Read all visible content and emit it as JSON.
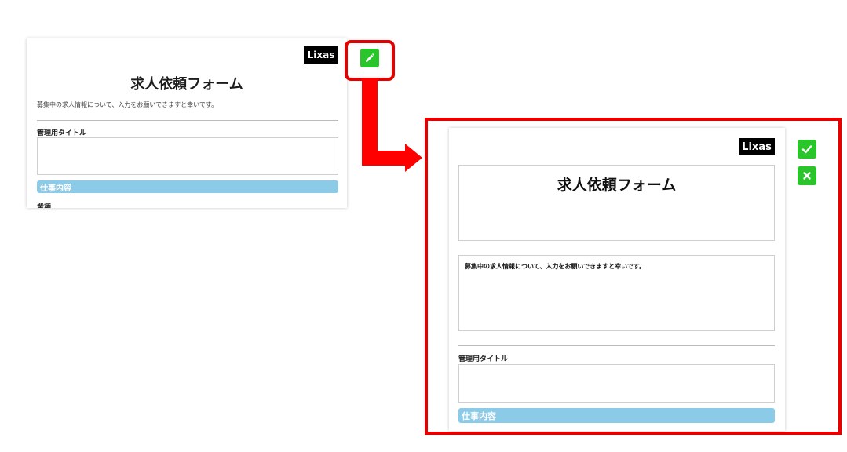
{
  "before": {
    "logo": "Lixas",
    "title": "求人依頼フォーム",
    "description": "募集中の求人情報について、入力をお願いできますと幸いです。",
    "field_label": "管理用タイトル",
    "section_label": "仕事内容",
    "cut_label": "業種"
  },
  "edit_icon": "pencil-icon",
  "after": {
    "logo": "Lixas",
    "title": "求人依頼フォーム",
    "description": "募集中の求人情報について、入力をお願いできますと幸いです。",
    "field_label": "管理用タイトル",
    "section_label": "仕事内容",
    "confirm_icon": "check-icon",
    "cancel_icon": "close-icon"
  },
  "colors": {
    "highlight": "#e60000",
    "arrow": "#ff0000",
    "button_green": "#2ac52a",
    "section_blue": "#8ccbe8",
    "logo_bg": "#000000"
  }
}
